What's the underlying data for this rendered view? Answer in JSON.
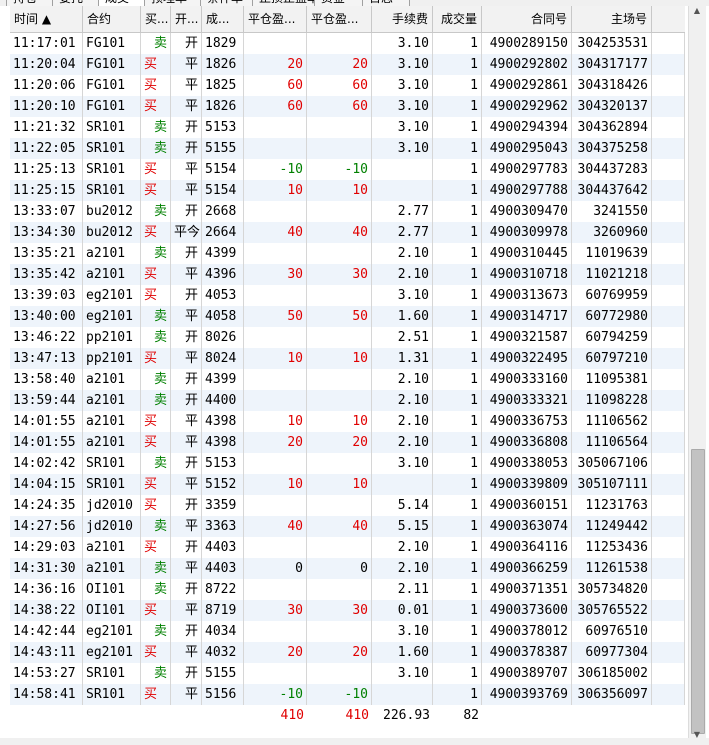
{
  "tabs": [
    "持仓",
    "委托",
    "成交",
    "预埋单",
    "条件单",
    "止损止盈单",
    "资金",
    "日志"
  ],
  "active_tab": 2,
  "columns": {
    "time": "时间 ▲",
    "contract": "合约",
    "side": "买...",
    "offset": "开...",
    "price": "成...",
    "pnl": "平仓盈...",
    "pnl2": "平仓盈...",
    "fee": "手续费",
    "volume": "成交量",
    "order_id": "合同号",
    "exch_id": "主场号"
  },
  "rows": [
    {
      "time": "11:17:01",
      "contract": "FG101",
      "side": "卖",
      "offset": "开",
      "price": "1829",
      "pnl": "",
      "pnl2": "",
      "fee": "3.10",
      "volume": "1",
      "order_id": "4900289150",
      "exch_id": "304253531"
    },
    {
      "time": "11:20:04",
      "contract": "FG101",
      "side": "买",
      "offset": "平",
      "price": "1826",
      "pnl": "20",
      "pnl2": "20",
      "fee": "3.10",
      "volume": "1",
      "order_id": "4900292802",
      "exch_id": "304317177"
    },
    {
      "time": "11:20:06",
      "contract": "FG101",
      "side": "买",
      "offset": "平",
      "price": "1825",
      "pnl": "60",
      "pnl2": "60",
      "fee": "3.10",
      "volume": "1",
      "order_id": "4900292861",
      "exch_id": "304318426"
    },
    {
      "time": "11:20:10",
      "contract": "FG101",
      "side": "买",
      "offset": "平",
      "price": "1826",
      "pnl": "60",
      "pnl2": "60",
      "fee": "3.10",
      "volume": "1",
      "order_id": "4900292962",
      "exch_id": "304320137"
    },
    {
      "time": "11:21:32",
      "contract": "SR101",
      "side": "卖",
      "offset": "开",
      "price": "5153",
      "pnl": "",
      "pnl2": "",
      "fee": "3.10",
      "volume": "1",
      "order_id": "4900294394",
      "exch_id": "304362894"
    },
    {
      "time": "11:22:05",
      "contract": "SR101",
      "side": "卖",
      "offset": "开",
      "price": "5155",
      "pnl": "",
      "pnl2": "",
      "fee": "3.10",
      "volume": "1",
      "order_id": "4900295043",
      "exch_id": "304375258"
    },
    {
      "time": "11:25:13",
      "contract": "SR101",
      "side": "买",
      "offset": "平",
      "price": "5154",
      "pnl": "-10",
      "pnl2": "-10",
      "fee": "",
      "volume": "1",
      "order_id": "4900297783",
      "exch_id": "304437283"
    },
    {
      "time": "11:25:15",
      "contract": "SR101",
      "side": "买",
      "offset": "平",
      "price": "5154",
      "pnl": "10",
      "pnl2": "10",
      "fee": "",
      "volume": "1",
      "order_id": "4900297788",
      "exch_id": "304437642"
    },
    {
      "time": "13:33:07",
      "contract": "bu2012",
      "side": "卖",
      "offset": "开",
      "price": "2668",
      "pnl": "",
      "pnl2": "",
      "fee": "2.77",
      "volume": "1",
      "order_id": "4900309470",
      "exch_id": "3241550"
    },
    {
      "time": "13:34:30",
      "contract": "bu2012",
      "side": "买",
      "offset": "平今",
      "price": "2664",
      "pnl": "40",
      "pnl2": "40",
      "fee": "2.77",
      "volume": "1",
      "order_id": "4900309978",
      "exch_id": "3260960"
    },
    {
      "time": "13:35:21",
      "contract": "a2101",
      "side": "卖",
      "offset": "开",
      "price": "4399",
      "pnl": "",
      "pnl2": "",
      "fee": "2.10",
      "volume": "1",
      "order_id": "4900310445",
      "exch_id": "11019639"
    },
    {
      "time": "13:35:42",
      "contract": "a2101",
      "side": "买",
      "offset": "平",
      "price": "4396",
      "pnl": "30",
      "pnl2": "30",
      "fee": "2.10",
      "volume": "1",
      "order_id": "4900310718",
      "exch_id": "11021218"
    },
    {
      "time": "13:39:03",
      "contract": "eg2101",
      "side": "买",
      "offset": "开",
      "price": "4053",
      "pnl": "",
      "pnl2": "",
      "fee": "3.10",
      "volume": "1",
      "order_id": "4900313673",
      "exch_id": "60769959"
    },
    {
      "time": "13:40:00",
      "contract": "eg2101",
      "side": "卖",
      "offset": "平",
      "price": "4058",
      "pnl": "50",
      "pnl2": "50",
      "fee": "1.60",
      "volume": "1",
      "order_id": "4900314717",
      "exch_id": "60772980"
    },
    {
      "time": "13:46:22",
      "contract": "pp2101",
      "side": "卖",
      "offset": "开",
      "price": "8026",
      "pnl": "",
      "pnl2": "",
      "fee": "2.51",
      "volume": "1",
      "order_id": "4900321587",
      "exch_id": "60794259"
    },
    {
      "time": "13:47:13",
      "contract": "pp2101",
      "side": "买",
      "offset": "平",
      "price": "8024",
      "pnl": "10",
      "pnl2": "10",
      "fee": "1.31",
      "volume": "1",
      "order_id": "4900322495",
      "exch_id": "60797210"
    },
    {
      "time": "13:58:40",
      "contract": "a2101",
      "side": "卖",
      "offset": "开",
      "price": "4399",
      "pnl": "",
      "pnl2": "",
      "fee": "2.10",
      "volume": "1",
      "order_id": "4900333160",
      "exch_id": "11095381"
    },
    {
      "time": "13:59:44",
      "contract": "a2101",
      "side": "卖",
      "offset": "开",
      "price": "4400",
      "pnl": "",
      "pnl2": "",
      "fee": "2.10",
      "volume": "1",
      "order_id": "4900333321",
      "exch_id": "11098228"
    },
    {
      "time": "14:01:55",
      "contract": "a2101",
      "side": "买",
      "offset": "平",
      "price": "4398",
      "pnl": "10",
      "pnl2": "10",
      "fee": "2.10",
      "volume": "1",
      "order_id": "4900336753",
      "exch_id": "11106562"
    },
    {
      "time": "14:01:55",
      "contract": "a2101",
      "side": "买",
      "offset": "平",
      "price": "4398",
      "pnl": "20",
      "pnl2": "20",
      "fee": "2.10",
      "volume": "1",
      "order_id": "4900336808",
      "exch_id": "11106564"
    },
    {
      "time": "14:02:42",
      "contract": "SR101",
      "side": "卖",
      "offset": "开",
      "price": "5153",
      "pnl": "",
      "pnl2": "",
      "fee": "3.10",
      "volume": "1",
      "order_id": "4900338053",
      "exch_id": "305067106"
    },
    {
      "time": "14:04:15",
      "contract": "SR101",
      "side": "买",
      "offset": "平",
      "price": "5152",
      "pnl": "10",
      "pnl2": "10",
      "fee": "",
      "volume": "1",
      "order_id": "4900339809",
      "exch_id": "305107111"
    },
    {
      "time": "14:24:35",
      "contract": "jd2010",
      "side": "买",
      "offset": "开",
      "price": "3359",
      "pnl": "",
      "pnl2": "",
      "fee": "5.14",
      "volume": "1",
      "order_id": "4900360151",
      "exch_id": "11231763"
    },
    {
      "time": "14:27:56",
      "contract": "jd2010",
      "side": "卖",
      "offset": "平",
      "price": "3363",
      "pnl": "40",
      "pnl2": "40",
      "fee": "5.15",
      "volume": "1",
      "order_id": "4900363074",
      "exch_id": "11249442"
    },
    {
      "time": "14:29:03",
      "contract": "a2101",
      "side": "买",
      "offset": "开",
      "price": "4403",
      "pnl": "",
      "pnl2": "",
      "fee": "2.10",
      "volume": "1",
      "order_id": "4900364116",
      "exch_id": "11253436"
    },
    {
      "time": "14:31:30",
      "contract": "a2101",
      "side": "卖",
      "offset": "平",
      "price": "4403",
      "pnl": "0",
      "pnl2": "0",
      "fee": "2.10",
      "volume": "1",
      "order_id": "4900366259",
      "exch_id": "11261538"
    },
    {
      "time": "14:36:16",
      "contract": "OI101",
      "side": "卖",
      "offset": "开",
      "price": "8722",
      "pnl": "",
      "pnl2": "",
      "fee": "2.11",
      "volume": "1",
      "order_id": "4900371351",
      "exch_id": "305734820"
    },
    {
      "time": "14:38:22",
      "contract": "OI101",
      "side": "买",
      "offset": "平",
      "price": "8719",
      "pnl": "30",
      "pnl2": "30",
      "fee": "0.01",
      "volume": "1",
      "order_id": "4900373600",
      "exch_id": "305765522"
    },
    {
      "time": "14:42:44",
      "contract": "eg2101",
      "side": "卖",
      "offset": "开",
      "price": "4034",
      "pnl": "",
      "pnl2": "",
      "fee": "3.10",
      "volume": "1",
      "order_id": "4900378012",
      "exch_id": "60976510"
    },
    {
      "time": "14:43:11",
      "contract": "eg2101",
      "side": "买",
      "offset": "平",
      "price": "4032",
      "pnl": "20",
      "pnl2": "20",
      "fee": "1.60",
      "volume": "1",
      "order_id": "4900378387",
      "exch_id": "60977304"
    },
    {
      "time": "14:53:27",
      "contract": "SR101",
      "side": "卖",
      "offset": "开",
      "price": "5155",
      "pnl": "",
      "pnl2": "",
      "fee": "3.10",
      "volume": "1",
      "order_id": "4900389707",
      "exch_id": "306185002"
    },
    {
      "time": "14:58:41",
      "contract": "SR101",
      "side": "买",
      "offset": "平",
      "price": "5156",
      "pnl": "-10",
      "pnl2": "-10",
      "fee": "",
      "volume": "1",
      "order_id": "4900393769",
      "exch_id": "306356097"
    }
  ],
  "totals": {
    "pnl": "410",
    "pnl2": "410",
    "fee": "226.93",
    "volume": "82"
  },
  "colors": {
    "buy": "#e00000",
    "sell": "#008000",
    "pnl": "#e00000",
    "pnl_negative": "#008000",
    "alt_row": "#eef4fb"
  }
}
